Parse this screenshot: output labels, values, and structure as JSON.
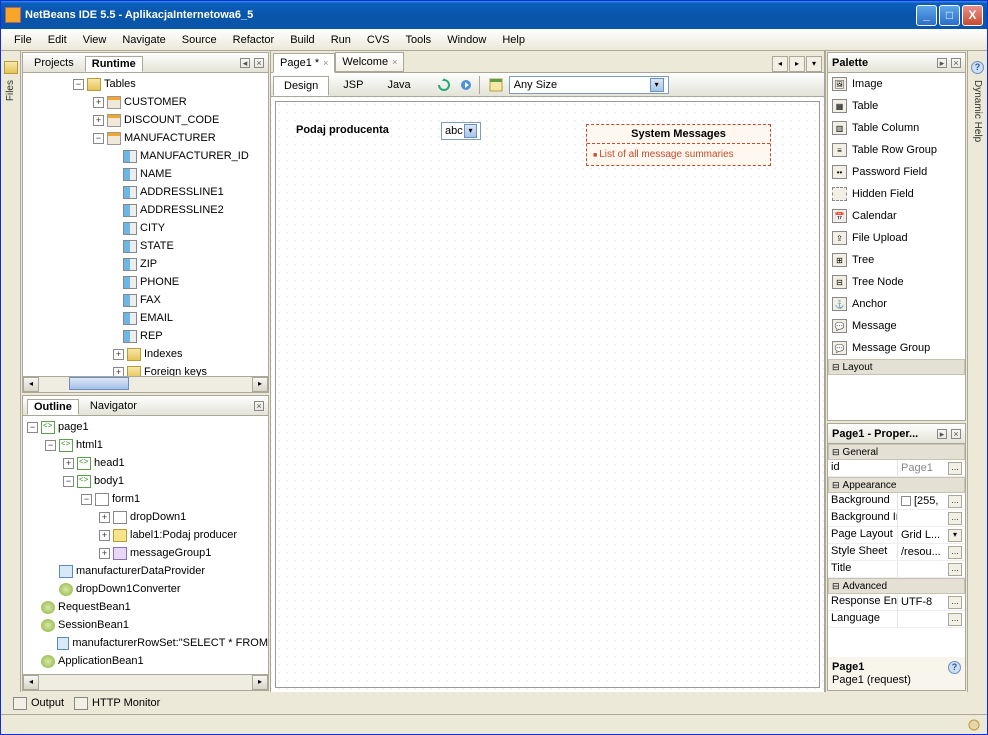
{
  "title": "NetBeans IDE 5.5 - AplikacjaInternetowa6_5",
  "menu": [
    "File",
    "Edit",
    "View",
    "Navigate",
    "Source",
    "Refactor",
    "Build",
    "Run",
    "CVS",
    "Tools",
    "Window",
    "Help"
  ],
  "left_vtab": "Files",
  "right_vtab": "Dynamic Help",
  "projects": {
    "tabs": [
      "Projects",
      "Runtime"
    ],
    "root": "Tables",
    "tables": [
      "CUSTOMER",
      "DISCOUNT_CODE",
      "MANUFACTURER"
    ],
    "manufacturer_cols": [
      "MANUFACTURER_ID",
      "NAME",
      "ADDRESSLINE1",
      "ADDRESSLINE2",
      "CITY",
      "STATE",
      "ZIP",
      "PHONE",
      "FAX",
      "EMAIL",
      "REP"
    ],
    "manufacturer_extra": [
      "Indexes",
      "Foreign keys"
    ]
  },
  "outline": {
    "tabs": [
      "Outline",
      "Navigator"
    ],
    "nodes": {
      "page1": "page1",
      "html1": "html1",
      "head1": "head1",
      "body1": "body1",
      "form1": "form1",
      "dropDown1": "dropDown1",
      "label1": "label1:Podaj producer",
      "messageGroup1": "messageGroup1",
      "mdp": "manufacturerDataProvider",
      "conv": "dropDown1Converter",
      "req": "RequestBean1",
      "sess": "SessionBean1",
      "rowset": "manufacturerRowSet:\"SELECT * FROM",
      "app": "ApplicationBean1"
    }
  },
  "editor": {
    "tabs": [
      {
        "label": "Page1 *"
      },
      {
        "label": "Welcome"
      }
    ],
    "subtabs": [
      "Design",
      "JSP",
      "Java"
    ],
    "sizebox": "Any Size",
    "form_label": "Podaj producenta",
    "dd_value": "abc",
    "msg_title": "System Messages",
    "msg_body": "List of all message summaries"
  },
  "palette": {
    "title": "Palette",
    "items": [
      "Image",
      "Table",
      "Table Column",
      "Table Row Group",
      "Password Field",
      "Hidden Field",
      "Calendar",
      "File Upload",
      "Tree",
      "Tree Node",
      "Anchor",
      "Message",
      "Message Group"
    ],
    "sec2": "Layout"
  },
  "props": {
    "title": "Page1 - Proper...",
    "sections": {
      "general": "General",
      "appearance": "Appearance",
      "advanced": "Advanced"
    },
    "rows": {
      "id_n": "id",
      "id_v": "Page1",
      "bg_n": "Background",
      "bg_v": "[255,",
      "bgi_n": "Background Im",
      "bgi_v": "",
      "pl_n": "Page Layout",
      "pl_v": "Grid L...",
      "ss_n": "Style Sheet",
      "ss_v": "/resou...",
      "ti_n": "Title",
      "ti_v": "",
      "re_n": "Response Enco",
      "re_v": "UTF-8",
      "la_n": "Language",
      "la_v": ""
    },
    "foot_name": "Page1",
    "foot_scope": "Page1 (request)"
  },
  "bottom": {
    "output": "Output",
    "http": "HTTP Monitor"
  }
}
